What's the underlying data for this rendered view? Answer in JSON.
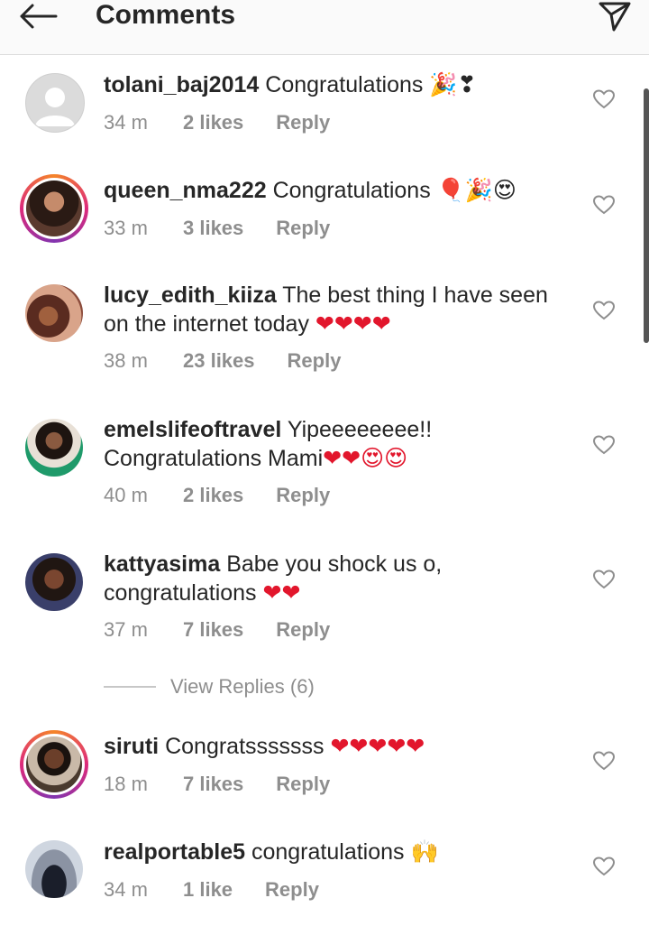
{
  "header": {
    "title": "Comments"
  },
  "comments": [
    {
      "username": "tolani_baj2014",
      "text": "Congratulations",
      "emoji": "🎉❣",
      "time": "34 m",
      "likes": "2 likes",
      "reply": "Reply",
      "avatar": "default-avatar"
    },
    {
      "username": "queen_nma222",
      "text": "Congratulations",
      "emoji": "🎈🎉😍",
      "time": "33 m",
      "likes": "3 likes",
      "reply": "Reply",
      "avatar": "story-ring-avatar"
    },
    {
      "username": "lucy_edith_kiiza",
      "text": "The best thing I have seen on the internet today",
      "emoji": "❤❤❤❤",
      "time": "38 m",
      "likes": "23 likes",
      "reply": "Reply",
      "avatar": "photo-avatar"
    },
    {
      "username": "emelslifeoftravel",
      "text": "Yipeeeeeeee!! Congratulations Mami",
      "emoji": "❤❤😍😍",
      "time": "40 m",
      "likes": "2 likes",
      "reply": "Reply",
      "avatar": "photo-avatar"
    },
    {
      "username": "kattyasima",
      "text": "Babe you shock us o, congratulations",
      "emoji": "❤❤",
      "time": "37 m",
      "likes": "7 likes",
      "reply": "Reply",
      "avatar": "photo-avatar"
    },
    {
      "username": "siruti",
      "text": "Congratsssssss",
      "emoji": "❤❤❤❤❤",
      "time": "18 m",
      "likes": "7 likes",
      "reply": "Reply",
      "avatar": "story-ring-avatar"
    },
    {
      "username": "realportable5",
      "text": "congratulations",
      "emoji": "🙌",
      "time": "34 m",
      "likes": "1 like",
      "reply": "Reply",
      "avatar": "photo-avatar"
    }
  ],
  "view_replies": {
    "label": "View Replies (6)"
  },
  "colors": {
    "username": "#262626",
    "meta": "#8e8e8e",
    "heart_emoji": "#e2162c",
    "header_bg": "#fafafa"
  }
}
